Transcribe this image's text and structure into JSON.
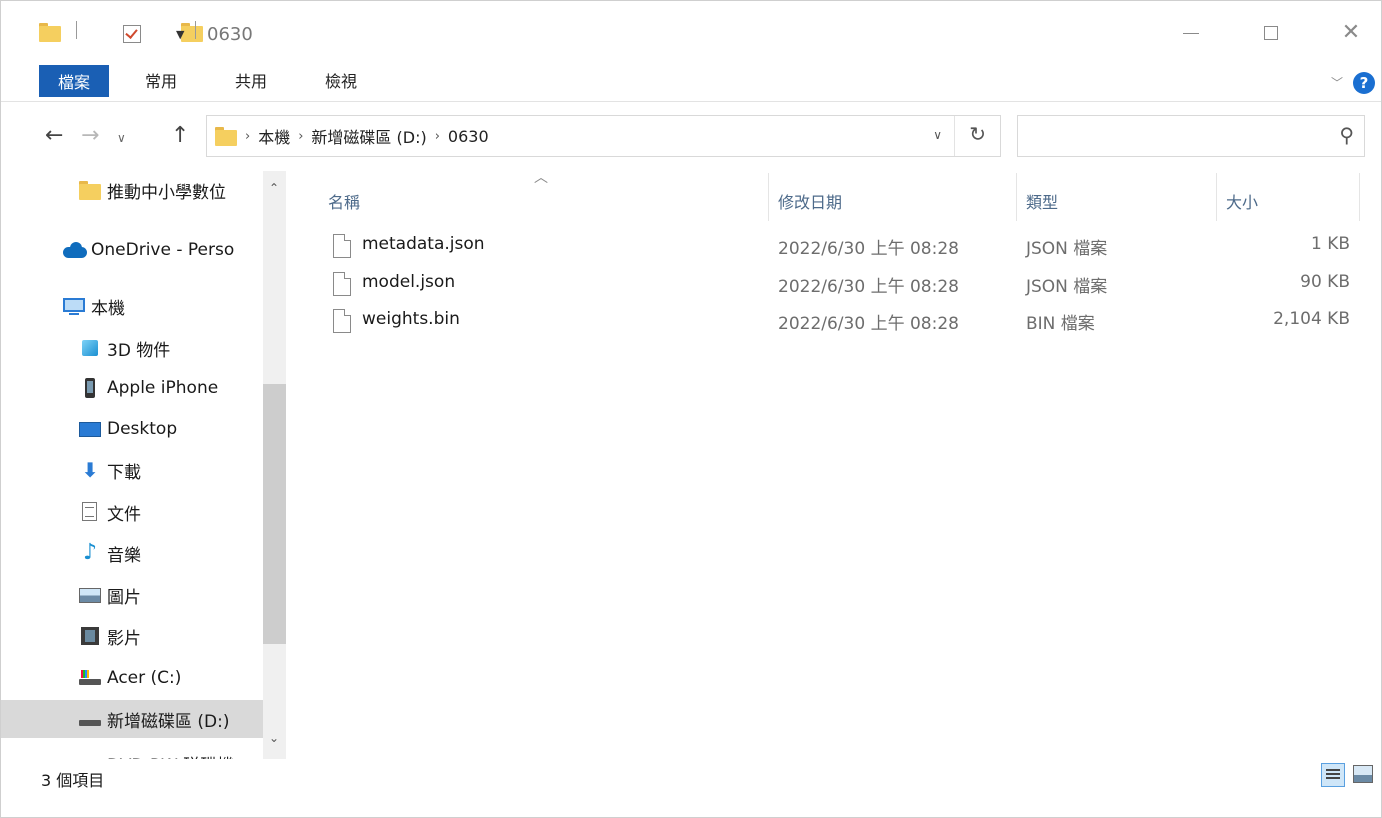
{
  "window": {
    "title": "0630"
  },
  "ribbon": {
    "tabs": [
      {
        "label": "檔案",
        "active": true
      },
      {
        "label": "常用"
      },
      {
        "label": "共用"
      },
      {
        "label": "檢視"
      }
    ]
  },
  "address": {
    "crumbs": [
      "本機",
      "新增磁碟區 (D:)",
      "0630"
    ],
    "search_value": ""
  },
  "sidebar": {
    "items": [
      {
        "label": "推動中小學數位",
        "icon": "folder-icon"
      },
      {
        "label": "OneDrive - Perso",
        "icon": "onedrive-cloud-icon"
      },
      {
        "label": "本機",
        "icon": "this-pc-icon"
      },
      {
        "label": "3D 物件",
        "icon": "3d-objects-icon"
      },
      {
        "label": "Apple iPhone",
        "icon": "iphone-icon"
      },
      {
        "label": "Desktop",
        "icon": "desktop-icon"
      },
      {
        "label": "下載",
        "icon": "download-arrow-icon"
      },
      {
        "label": "文件",
        "icon": "documents-icon"
      },
      {
        "label": "音樂",
        "icon": "music-note-icon"
      },
      {
        "label": "圖片",
        "icon": "pictures-icon"
      },
      {
        "label": "影片",
        "icon": "video-icon"
      },
      {
        "label": "Acer (C:)",
        "icon": "drive-c-icon"
      },
      {
        "label": "新增磁碟區 (D:)",
        "icon": "drive-d-icon",
        "selected": true
      },
      {
        "label": "DVD RW 磁碟機",
        "icon": "dvd-drive-icon"
      }
    ]
  },
  "files": {
    "columns": [
      "名稱",
      "修改日期",
      "類型",
      "大小"
    ],
    "rows": [
      {
        "name": "metadata.json",
        "date": "2022/6/30 上午 08:28",
        "type": "JSON 檔案",
        "size": "1 KB"
      },
      {
        "name": "model.json",
        "date": "2022/6/30 上午 08:28",
        "type": "JSON 檔案",
        "size": "90 KB"
      },
      {
        "name": "weights.bin",
        "date": "2022/6/30 上午 08:28",
        "type": "BIN 檔案",
        "size": "2,104 KB"
      }
    ]
  },
  "status": {
    "item_count": "3 個項目"
  },
  "colors": {
    "accent": "#1a5fb4",
    "folder": "#f5cf5f",
    "selection": "#d9d9d9"
  }
}
